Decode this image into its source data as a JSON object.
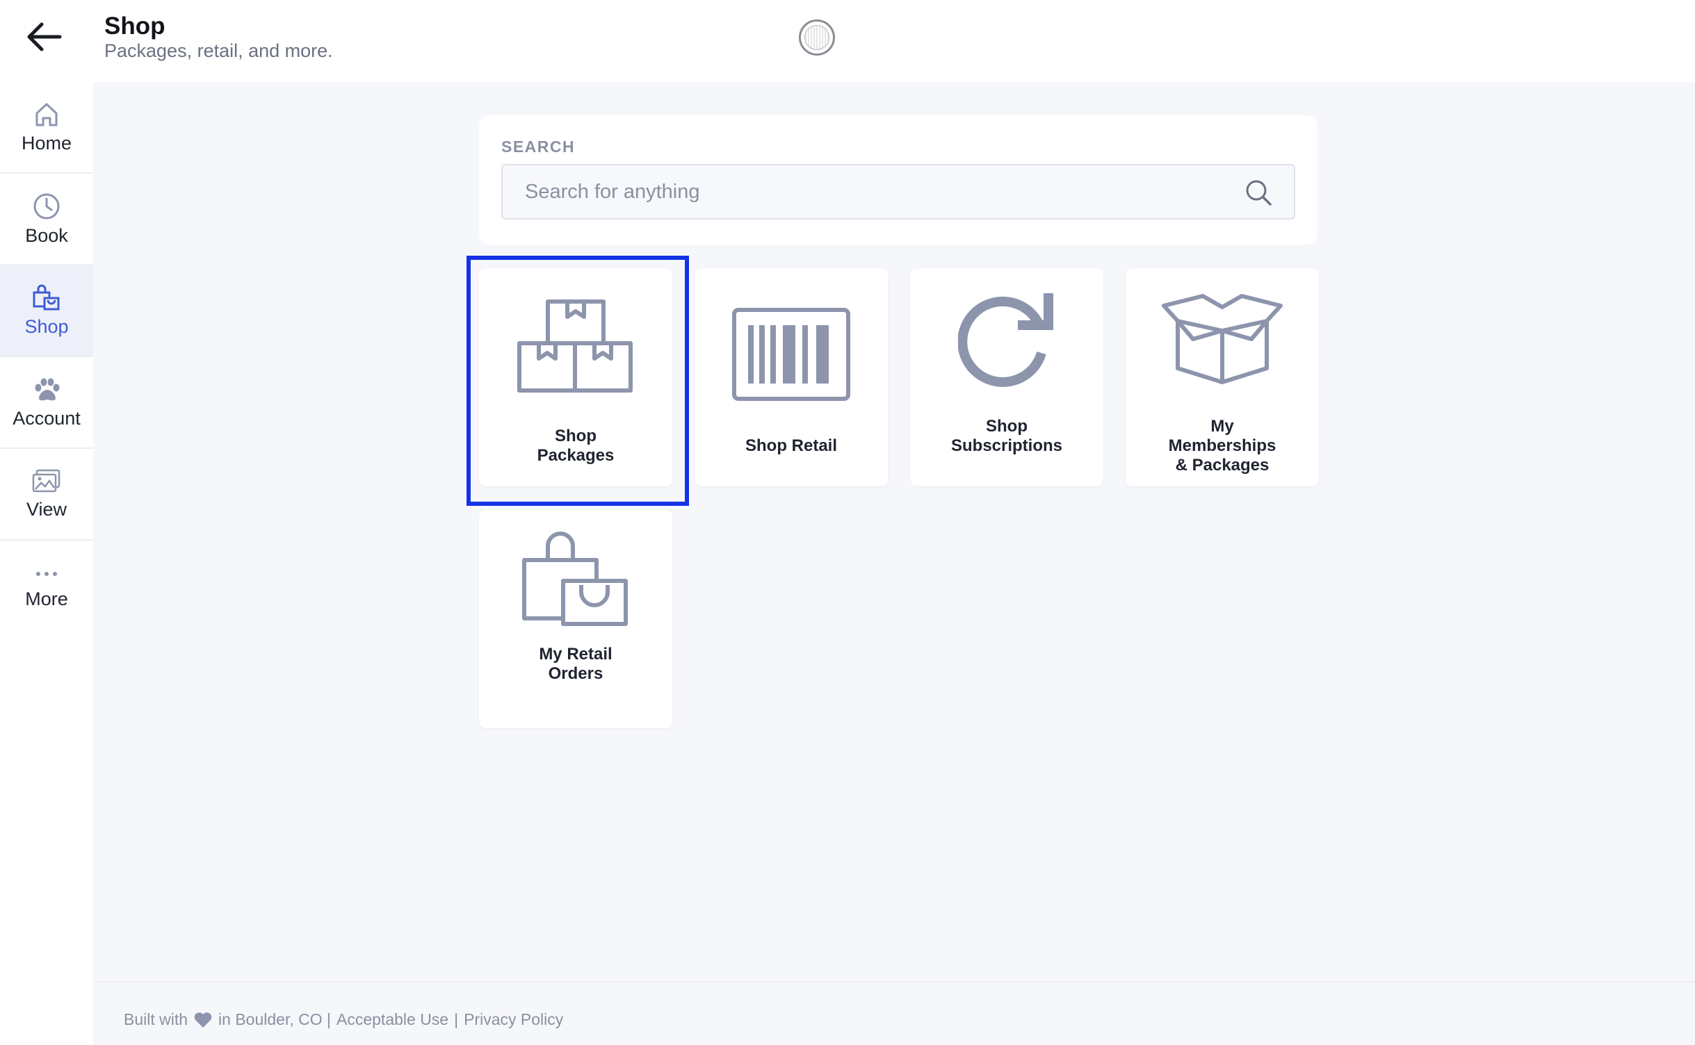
{
  "header": {
    "title": "Shop",
    "subtitle": "Packages, retail, and more."
  },
  "sidebar": {
    "items": [
      {
        "label": "Home",
        "icon": "home-icon"
      },
      {
        "label": "Book",
        "icon": "clock-icon"
      },
      {
        "label": "Shop",
        "icon": "shopping-bag-icon",
        "active": true
      },
      {
        "label": "Account",
        "icon": "paw-icon"
      },
      {
        "label": "View",
        "icon": "images-icon"
      },
      {
        "label": "More",
        "icon": "more-dots-icon"
      }
    ]
  },
  "search": {
    "label": "SEARCH",
    "placeholder": "Search for anything",
    "value": ""
  },
  "tiles": [
    {
      "line1": "Shop",
      "line2": "Packages",
      "icon": "boxes-icon"
    },
    {
      "line1": "Shop Retail",
      "icon": "barcode-icon"
    },
    {
      "line1": "Shop",
      "line2": "Subscriptions",
      "icon": "refresh-icon"
    },
    {
      "line1": "My",
      "line2": "Memberships",
      "line3": "& Packages",
      "icon": "open-box-icon"
    },
    {
      "line1": "My Retail",
      "line2": "Orders",
      "icon": "bags-icon"
    }
  ],
  "footer": {
    "built_with": "Built with",
    "location": "in Boulder, CO |",
    "acceptable_use": "Acceptable Use",
    "separator": "|",
    "privacy": "Privacy Policy"
  },
  "colors": {
    "accent": "#3f5bd6",
    "highlight": "#1432e6",
    "icon": "#8d95ad",
    "background": "#f6f7fb"
  }
}
